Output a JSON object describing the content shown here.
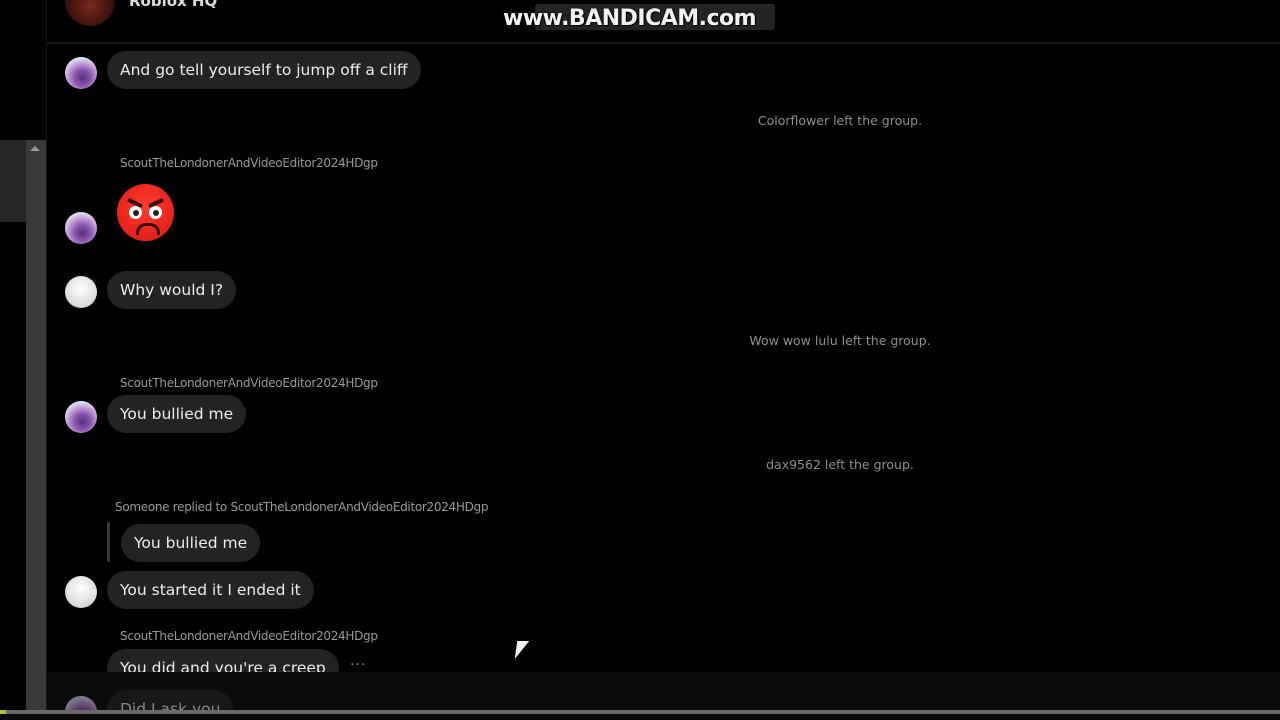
{
  "watermark": {
    "text": "www.BANDICAM.com"
  },
  "header": {
    "group_name": "Roblox HQ"
  },
  "messages": [
    {
      "type": "bubble",
      "text": "And go tell yourself to jump off a cliff",
      "avatar": "colorful-avatar"
    },
    {
      "type": "system",
      "text": "Colorflower left the group."
    },
    {
      "type": "sender",
      "text": "ScoutTheLondonerAndVideoEditor2024HDgp"
    },
    {
      "type": "emoji",
      "text": "angry-face-emoji"
    },
    {
      "type": "bubble",
      "text": "Why would I?",
      "avatar": "blank-avatar"
    },
    {
      "type": "system",
      "text": "Wow wow lulu left the group."
    },
    {
      "type": "sender",
      "text": "ScoutTheLondonerAndVideoEditor2024HDgp"
    },
    {
      "type": "bubble",
      "text": "You bullied me",
      "avatar": "colorful-avatar"
    },
    {
      "type": "system",
      "text": "dax9562 left the group."
    },
    {
      "type": "reply_header",
      "text": "Someone replied to ScoutTheLondonerAndVideoEditor2024HDgp"
    },
    {
      "type": "reply_quote",
      "text": "You bullied me"
    },
    {
      "type": "bubble",
      "text": "You started it I ended it",
      "avatar": "blank-avatar"
    },
    {
      "type": "sender",
      "text": "ScoutTheLondonerAndVideoEditor2024HDgp"
    },
    {
      "type": "bubble",
      "text": "You did and you're a creep"
    },
    {
      "type": "bubble",
      "text": "Did I ask you",
      "avatar": "colorful-avatar"
    }
  ],
  "more_actions": {
    "label": "···"
  },
  "colors": {
    "background": "#000000",
    "bubble": "#232323",
    "system_text": "#8f8f8f",
    "emoji_red": "#e5231b"
  }
}
